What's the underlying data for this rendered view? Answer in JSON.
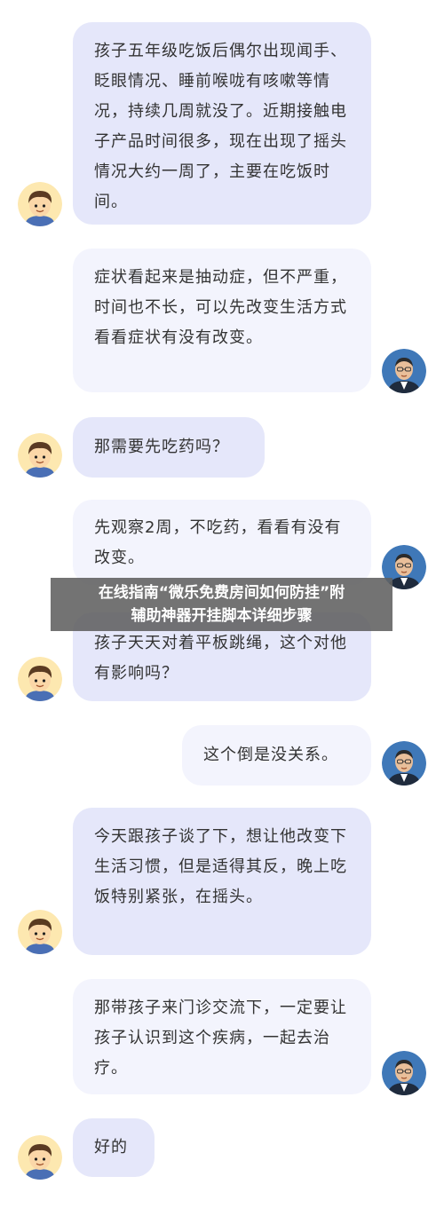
{
  "messages": [
    {
      "role": "patient",
      "text": "孩子五年级吃饭后偶尔出现闻手、眨眼情况、睡前喉咙有咳嗽等情况，持续几周就没了。近期接触电子产品时间很多，现在出现了摇头情况大约一周了，主要在吃饭时间。"
    },
    {
      "role": "doctor",
      "text": "症状看起来是抽动症，但不严重，时间也不长，可以先改变生活方式看看症状有没有改变。"
    },
    {
      "role": "patient",
      "text": "那需要先吃药吗？"
    },
    {
      "role": "doctor",
      "text": "先观察2周，不吃药，看看有没有改变。"
    },
    {
      "role": "patient",
      "text": "孩子天天对着平板跳绳，这个对他有影响吗？"
    },
    {
      "role": "doctor",
      "text": "这个倒是没关系。"
    },
    {
      "role": "patient",
      "text": "今天跟孩子谈了下，想让他改变下生活习惯，但是适得其反，晚上吃饭特别紧张，在摇头。"
    },
    {
      "role": "doctor",
      "text": "那带孩子来门诊交流下，一定要让孩子认识到这个疾病，一起去治疗。"
    },
    {
      "role": "patient",
      "text": "好的"
    }
  ],
  "banner": {
    "line1": "在线指南“微乐免费房间如何防挂”附",
    "line2": "辅助神器开挂脚本详细步骤"
  },
  "colors": {
    "patient_bubble": "#e5e7fa",
    "doctor_bubble": "#f3f4fd",
    "text": "#333333"
  }
}
